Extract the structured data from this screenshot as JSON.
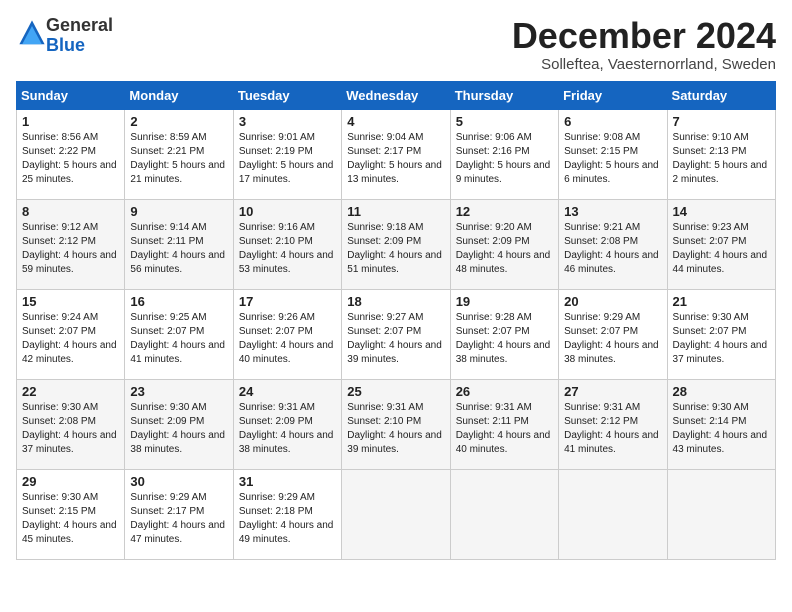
{
  "header": {
    "logo": {
      "line1": "General",
      "line2": "Blue"
    },
    "month": "December 2024",
    "location": "Solleftea, Vaesternorrland, Sweden"
  },
  "weekdays": [
    "Sunday",
    "Monday",
    "Tuesday",
    "Wednesday",
    "Thursday",
    "Friday",
    "Saturday"
  ],
  "weeks": [
    [
      {
        "day": 1,
        "sunrise": "Sunrise: 8:56 AM",
        "sunset": "Sunset: 2:22 PM",
        "daylight": "Daylight: 5 hours and 25 minutes."
      },
      {
        "day": 2,
        "sunrise": "Sunrise: 8:59 AM",
        "sunset": "Sunset: 2:21 PM",
        "daylight": "Daylight: 5 hours and 21 minutes."
      },
      {
        "day": 3,
        "sunrise": "Sunrise: 9:01 AM",
        "sunset": "Sunset: 2:19 PM",
        "daylight": "Daylight: 5 hours and 17 minutes."
      },
      {
        "day": 4,
        "sunrise": "Sunrise: 9:04 AM",
        "sunset": "Sunset: 2:17 PM",
        "daylight": "Daylight: 5 hours and 13 minutes."
      },
      {
        "day": 5,
        "sunrise": "Sunrise: 9:06 AM",
        "sunset": "Sunset: 2:16 PM",
        "daylight": "Daylight: 5 hours and 9 minutes."
      },
      {
        "day": 6,
        "sunrise": "Sunrise: 9:08 AM",
        "sunset": "Sunset: 2:15 PM",
        "daylight": "Daylight: 5 hours and 6 minutes."
      },
      {
        "day": 7,
        "sunrise": "Sunrise: 9:10 AM",
        "sunset": "Sunset: 2:13 PM",
        "daylight": "Daylight: 5 hours and 2 minutes."
      }
    ],
    [
      {
        "day": 8,
        "sunrise": "Sunrise: 9:12 AM",
        "sunset": "Sunset: 2:12 PM",
        "daylight": "Daylight: 4 hours and 59 minutes."
      },
      {
        "day": 9,
        "sunrise": "Sunrise: 9:14 AM",
        "sunset": "Sunset: 2:11 PM",
        "daylight": "Daylight: 4 hours and 56 minutes."
      },
      {
        "day": 10,
        "sunrise": "Sunrise: 9:16 AM",
        "sunset": "Sunset: 2:10 PM",
        "daylight": "Daylight: 4 hours and 53 minutes."
      },
      {
        "day": 11,
        "sunrise": "Sunrise: 9:18 AM",
        "sunset": "Sunset: 2:09 PM",
        "daylight": "Daylight: 4 hours and 51 minutes."
      },
      {
        "day": 12,
        "sunrise": "Sunrise: 9:20 AM",
        "sunset": "Sunset: 2:09 PM",
        "daylight": "Daylight: 4 hours and 48 minutes."
      },
      {
        "day": 13,
        "sunrise": "Sunrise: 9:21 AM",
        "sunset": "Sunset: 2:08 PM",
        "daylight": "Daylight: 4 hours and 46 minutes."
      },
      {
        "day": 14,
        "sunrise": "Sunrise: 9:23 AM",
        "sunset": "Sunset: 2:07 PM",
        "daylight": "Daylight: 4 hours and 44 minutes."
      }
    ],
    [
      {
        "day": 15,
        "sunrise": "Sunrise: 9:24 AM",
        "sunset": "Sunset: 2:07 PM",
        "daylight": "Daylight: 4 hours and 42 minutes."
      },
      {
        "day": 16,
        "sunrise": "Sunrise: 9:25 AM",
        "sunset": "Sunset: 2:07 PM",
        "daylight": "Daylight: 4 hours and 41 minutes."
      },
      {
        "day": 17,
        "sunrise": "Sunrise: 9:26 AM",
        "sunset": "Sunset: 2:07 PM",
        "daylight": "Daylight: 4 hours and 40 minutes."
      },
      {
        "day": 18,
        "sunrise": "Sunrise: 9:27 AM",
        "sunset": "Sunset: 2:07 PM",
        "daylight": "Daylight: 4 hours and 39 minutes."
      },
      {
        "day": 19,
        "sunrise": "Sunrise: 9:28 AM",
        "sunset": "Sunset: 2:07 PM",
        "daylight": "Daylight: 4 hours and 38 minutes."
      },
      {
        "day": 20,
        "sunrise": "Sunrise: 9:29 AM",
        "sunset": "Sunset: 2:07 PM",
        "daylight": "Daylight: 4 hours and 38 minutes."
      },
      {
        "day": 21,
        "sunrise": "Sunrise: 9:30 AM",
        "sunset": "Sunset: 2:07 PM",
        "daylight": "Daylight: 4 hours and 37 minutes."
      }
    ],
    [
      {
        "day": 22,
        "sunrise": "Sunrise: 9:30 AM",
        "sunset": "Sunset: 2:08 PM",
        "daylight": "Daylight: 4 hours and 37 minutes."
      },
      {
        "day": 23,
        "sunrise": "Sunrise: 9:30 AM",
        "sunset": "Sunset: 2:09 PM",
        "daylight": "Daylight: 4 hours and 38 minutes."
      },
      {
        "day": 24,
        "sunrise": "Sunrise: 9:31 AM",
        "sunset": "Sunset: 2:09 PM",
        "daylight": "Daylight: 4 hours and 38 minutes."
      },
      {
        "day": 25,
        "sunrise": "Sunrise: 9:31 AM",
        "sunset": "Sunset: 2:10 PM",
        "daylight": "Daylight: 4 hours and 39 minutes."
      },
      {
        "day": 26,
        "sunrise": "Sunrise: 9:31 AM",
        "sunset": "Sunset: 2:11 PM",
        "daylight": "Daylight: 4 hours and 40 minutes."
      },
      {
        "day": 27,
        "sunrise": "Sunrise: 9:31 AM",
        "sunset": "Sunset: 2:12 PM",
        "daylight": "Daylight: 4 hours and 41 minutes."
      },
      {
        "day": 28,
        "sunrise": "Sunrise: 9:30 AM",
        "sunset": "Sunset: 2:14 PM",
        "daylight": "Daylight: 4 hours and 43 minutes."
      }
    ],
    [
      {
        "day": 29,
        "sunrise": "Sunrise: 9:30 AM",
        "sunset": "Sunset: 2:15 PM",
        "daylight": "Daylight: 4 hours and 45 minutes."
      },
      {
        "day": 30,
        "sunrise": "Sunrise: 9:29 AM",
        "sunset": "Sunset: 2:17 PM",
        "daylight": "Daylight: 4 hours and 47 minutes."
      },
      {
        "day": 31,
        "sunrise": "Sunrise: 9:29 AM",
        "sunset": "Sunset: 2:18 PM",
        "daylight": "Daylight: 4 hours and 49 minutes."
      },
      null,
      null,
      null,
      null
    ]
  ]
}
